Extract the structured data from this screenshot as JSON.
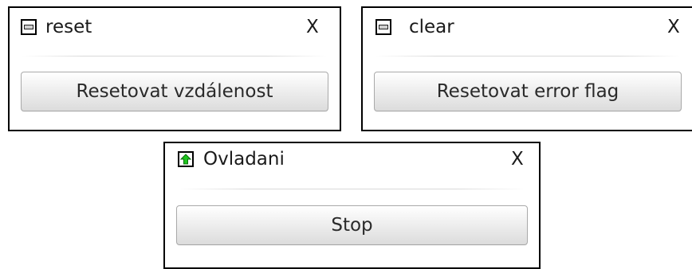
{
  "panels": {
    "reset": {
      "title": "reset",
      "close_label": "X",
      "icon": "slider-icon",
      "button_label": "Resetovat vzdálenost"
    },
    "clear": {
      "title": "clear",
      "close_label": "X",
      "icon": "slider-icon",
      "button_label": "Resetovat error flag"
    },
    "ovladani": {
      "title": "Ovladani",
      "close_label": "X",
      "icon": "green-up-arrow-icon",
      "icon_color": "#1fc51f",
      "button_label": "Stop"
    }
  }
}
